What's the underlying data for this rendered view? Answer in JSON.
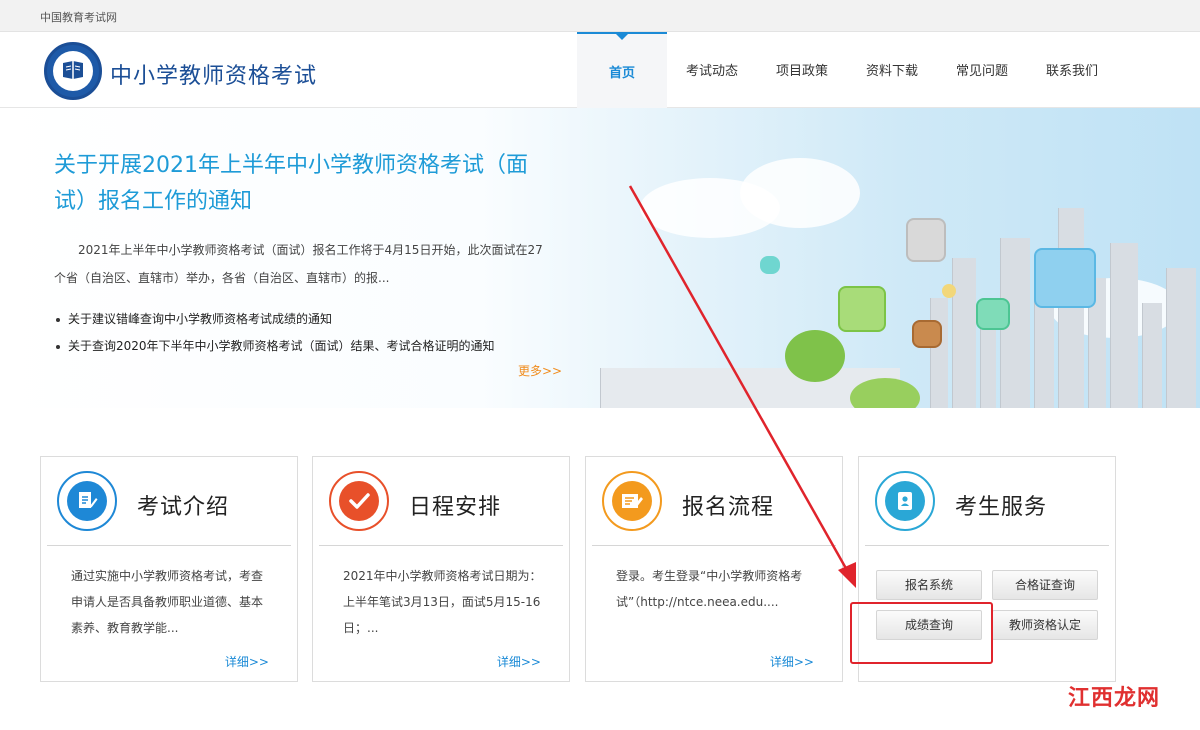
{
  "topbar": {
    "site_name": "中国教育考试网"
  },
  "header": {
    "title": "中小学教师资格考试",
    "nav": [
      {
        "label": "首页",
        "active": true
      },
      {
        "label": "考试动态"
      },
      {
        "label": "项目政策"
      },
      {
        "label": "资料下载"
      },
      {
        "label": "常见问题"
      },
      {
        "label": "联系我们"
      }
    ]
  },
  "banner": {
    "title": "关于开展2021年上半年中小学教师资格考试（面试）报名工作的通知",
    "description": "2021年上半年中小学教师资格考试（面试）报名工作将于4月15日开始，此次面试在27个省（自治区、直辖市）举办，各省（自治区、直辖市）的报...",
    "links": [
      "关于建议错峰查询中小学教师资格考试成绩的通知",
      "关于查询2020年下半年中小学教师资格考试（面试）结果、考试合格证明的通知"
    ],
    "more": "更多>>"
  },
  "cards": [
    {
      "title": "考试介绍",
      "text": "通过实施中小学教师资格考试，考查申请人是否具备教师职业道德、基本素养、教育教学能...",
      "more": "详细>>",
      "icon": "document-pen-icon",
      "color": "#1e88d6"
    },
    {
      "title": "日程安排",
      "text": "2021年中小学教师资格考试日期为：上半年笔试3月13日，面试5月15-16日；...",
      "more": "详细>>",
      "icon": "checkmark-icon",
      "color": "#e8502a"
    },
    {
      "title": "报名流程",
      "text": "登录。考生登录“中小学教师资格考试”（http://ntce.neea.edu....",
      "more": "详细>>",
      "icon": "form-edit-icon",
      "color": "#f39a1e"
    },
    {
      "title": "考生服务",
      "icon": "contact-book-icon",
      "color": "#2aa7d6",
      "buttons": [
        "报名系统",
        "合格证查询",
        "成绩查询",
        "教师资格认定"
      ]
    }
  ],
  "watermark": "江西龙网",
  "colors": {
    "accent": "#1b8ad6",
    "highlight": "#e0242c",
    "more": "#f08c1e"
  }
}
